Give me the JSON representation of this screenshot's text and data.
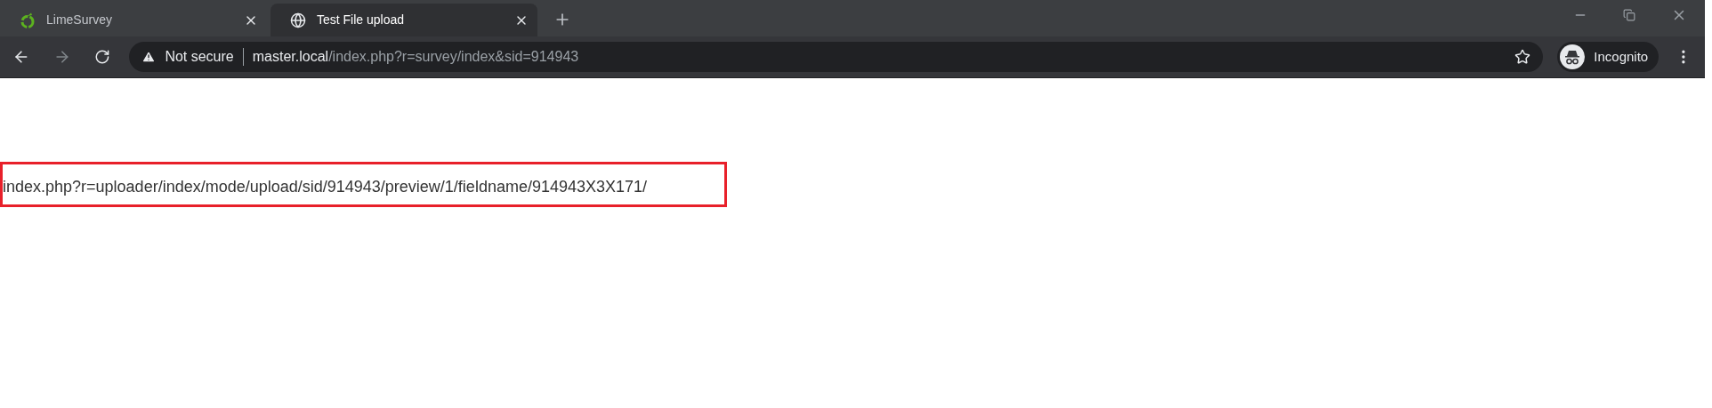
{
  "tabs": [
    {
      "kind": "lime",
      "title": "LimeSurvey",
      "selected": false
    },
    {
      "kind": "globe",
      "title": "Test File upload",
      "selected": true
    }
  ],
  "address": {
    "security": "Not secure",
    "host": "master.local",
    "path": "/index.php?r=survey/index&sid=914943"
  },
  "profile": "Incognito",
  "page": {
    "highlighted_text": "index.php?r=uploader/index/mode/upload/sid/914943/preview/1/fieldname/914943X3X171/"
  }
}
